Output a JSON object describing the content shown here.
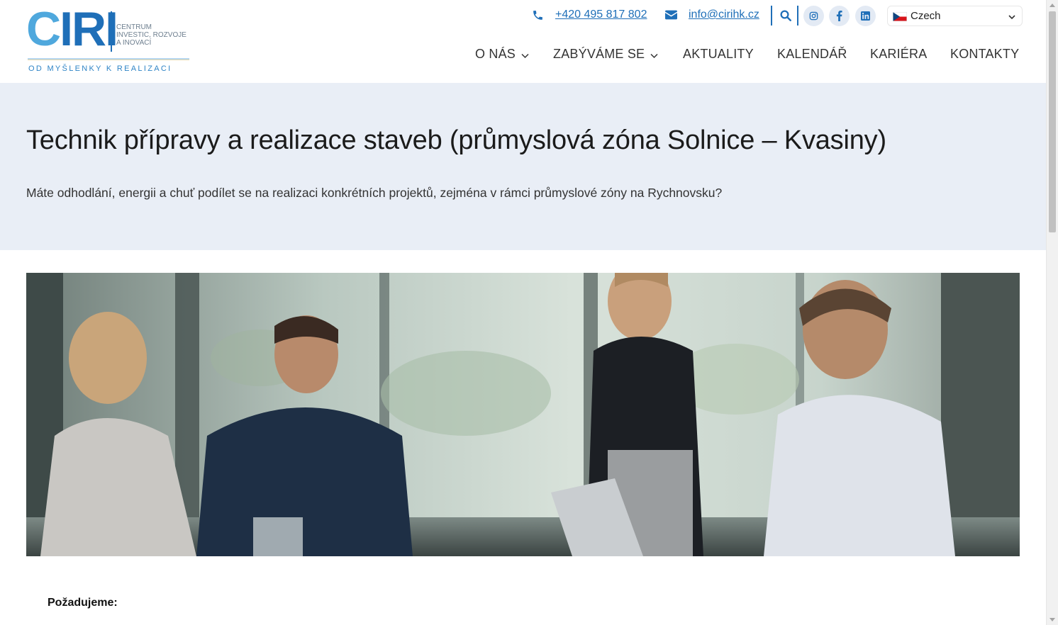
{
  "logo": {
    "mark": "CIRI",
    "subtitle": [
      "CENTRUM",
      "INVESTIC, ROZVOJE",
      "A INOVACÍ"
    ],
    "tagline": "OD MYŠLENKY K REALIZACI"
  },
  "topbar": {
    "phone": "+420 495 817 802",
    "email": "info@cirihk.cz",
    "language": "Czech"
  },
  "nav": {
    "items": [
      {
        "label": "O NÁS",
        "dropdown": true
      },
      {
        "label": "ZABÝVÁME SE",
        "dropdown": true
      },
      {
        "label": "AKTUALITY",
        "dropdown": false
      },
      {
        "label": "KALENDÁŘ",
        "dropdown": false
      },
      {
        "label": "KARIÉRA",
        "dropdown": false
      },
      {
        "label": "KONTAKTY",
        "dropdown": false
      }
    ]
  },
  "hero": {
    "title": "Technik přípravy a realizace staveb (průmyslová zóna Solnice – Kvasiny)",
    "lead": "Máte odhodlání, energii a chuť podílet se na realizaci konkrétních projektů, zejména v rámci průmyslové zóny na Rychnovsku?"
  },
  "content": {
    "requirements_heading": "Požadujeme:"
  },
  "colors": {
    "brand_blue": "#1f6fb8",
    "light_blue": "#4fa8dd",
    "hero_bg": "#e9eef6",
    "social_bg": "#e3eaf4"
  },
  "icons": [
    "phone-icon",
    "envelope-icon",
    "search-icon",
    "instagram-icon",
    "facebook-icon",
    "linkedin-icon",
    "czech-flag-icon",
    "chevron-down-icon"
  ]
}
